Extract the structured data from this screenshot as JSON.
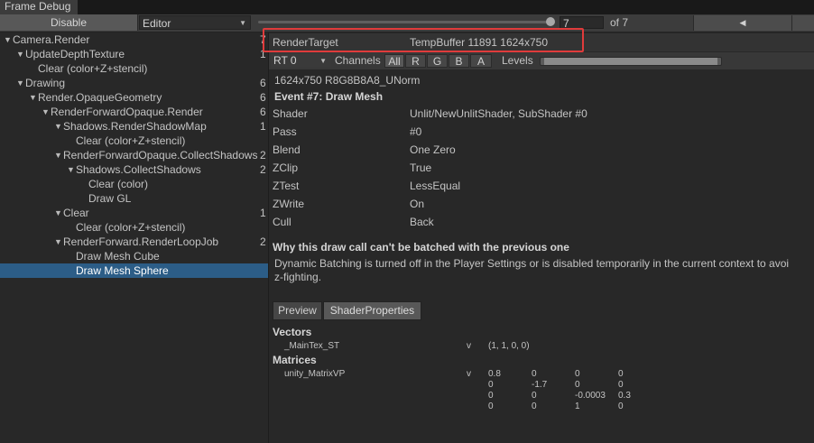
{
  "window": {
    "tab_title": "Frame Debug"
  },
  "toolbar": {
    "disable_label": "Disable",
    "mode": "Editor",
    "event_index": "7",
    "of_label": "of 7",
    "slider_fraction": 1.0,
    "prev_glyph": "◀"
  },
  "tree": [
    {
      "label": "Camera.Render",
      "count": "7",
      "depth": 0,
      "expanded": true,
      "has_children": true
    },
    {
      "label": "UpdateDepthTexture",
      "count": "1",
      "depth": 1,
      "expanded": true,
      "has_children": true
    },
    {
      "label": "Clear (color+Z+stencil)",
      "count": "",
      "depth": 2,
      "expanded": false,
      "has_children": false
    },
    {
      "label": "Drawing",
      "count": "6",
      "depth": 1,
      "expanded": true,
      "has_children": true
    },
    {
      "label": "Render.OpaqueGeometry",
      "count": "6",
      "depth": 2,
      "expanded": true,
      "has_children": true
    },
    {
      "label": "RenderForwardOpaque.Render",
      "count": "6",
      "depth": 3,
      "expanded": true,
      "has_children": true
    },
    {
      "label": "Shadows.RenderShadowMap",
      "count": "1",
      "depth": 4,
      "expanded": true,
      "has_children": true
    },
    {
      "label": "Clear (color+Z+stencil)",
      "count": "",
      "depth": 5,
      "expanded": false,
      "has_children": false
    },
    {
      "label": "RenderForwardOpaque.CollectShadows",
      "count": "2",
      "depth": 4,
      "expanded": true,
      "has_children": true
    },
    {
      "label": "Shadows.CollectShadows",
      "count": "2",
      "depth": 5,
      "expanded": true,
      "has_children": true
    },
    {
      "label": "Clear (color)",
      "count": "",
      "depth": 6,
      "expanded": false,
      "has_children": false
    },
    {
      "label": "Draw GL",
      "count": "",
      "depth": 6,
      "expanded": false,
      "has_children": false
    },
    {
      "label": "Clear",
      "count": "1",
      "depth": 4,
      "expanded": true,
      "has_children": true
    },
    {
      "label": "Clear (color+Z+stencil)",
      "count": "",
      "depth": 5,
      "expanded": false,
      "has_children": false
    },
    {
      "label": "RenderForward.RenderLoopJob",
      "count": "2",
      "depth": 4,
      "expanded": true,
      "has_children": true
    },
    {
      "label": "Draw Mesh Cube",
      "count": "",
      "depth": 5,
      "expanded": false,
      "has_children": false
    },
    {
      "label": "Draw Mesh Sphere",
      "count": "",
      "depth": 5,
      "expanded": false,
      "has_children": false,
      "selected": true
    }
  ],
  "render_target": {
    "label": "RenderTarget",
    "value": "TempBuffer 11891 1624x750"
  },
  "channels": {
    "rt_select": "RT 0",
    "label": "Channels",
    "buttons": [
      "All",
      "R",
      "G",
      "B",
      "A"
    ],
    "levels_label": "Levels"
  },
  "format": "1624x750 R8G8B8A8_UNorm",
  "event_title": "Event #7: Draw Mesh",
  "properties": [
    {
      "label": "Shader",
      "value": "Unlit/NewUnlitShader, SubShader #0"
    },
    {
      "label": "Pass",
      "value": "#0"
    },
    {
      "label": "Blend",
      "value": "One Zero"
    },
    {
      "label": "ZClip",
      "value": "True"
    },
    {
      "label": "ZTest",
      "value": "LessEqual"
    },
    {
      "label": "ZWrite",
      "value": "On"
    },
    {
      "label": "Cull",
      "value": "Back"
    }
  ],
  "batching": {
    "title": "Why this draw call can't be batched with the previous one",
    "line1": "Dynamic Batching is turned off in the Player Settings or is disabled temporarily in the current context to avoi",
    "line2": "z-fighting."
  },
  "bottom_tabs": {
    "preview": "Preview",
    "shader_properties": "ShaderProperties"
  },
  "vectors": {
    "title": "Vectors",
    "items": [
      {
        "name": "_MainTex_ST",
        "stage": "v",
        "value": "(1, 1, 0, 0)"
      }
    ]
  },
  "matrices": {
    "title": "Matrices",
    "items": [
      {
        "name": "unity_MatrixVP",
        "stage": "v",
        "rows": [
          [
            "0.8",
            "0",
            "0",
            "0"
          ],
          [
            "0",
            "-1.7",
            "0",
            "0"
          ],
          [
            "0",
            "0",
            "-0.0003",
            "0.3"
          ],
          [
            "0",
            "0",
            "1",
            "0"
          ]
        ]
      }
    ]
  }
}
